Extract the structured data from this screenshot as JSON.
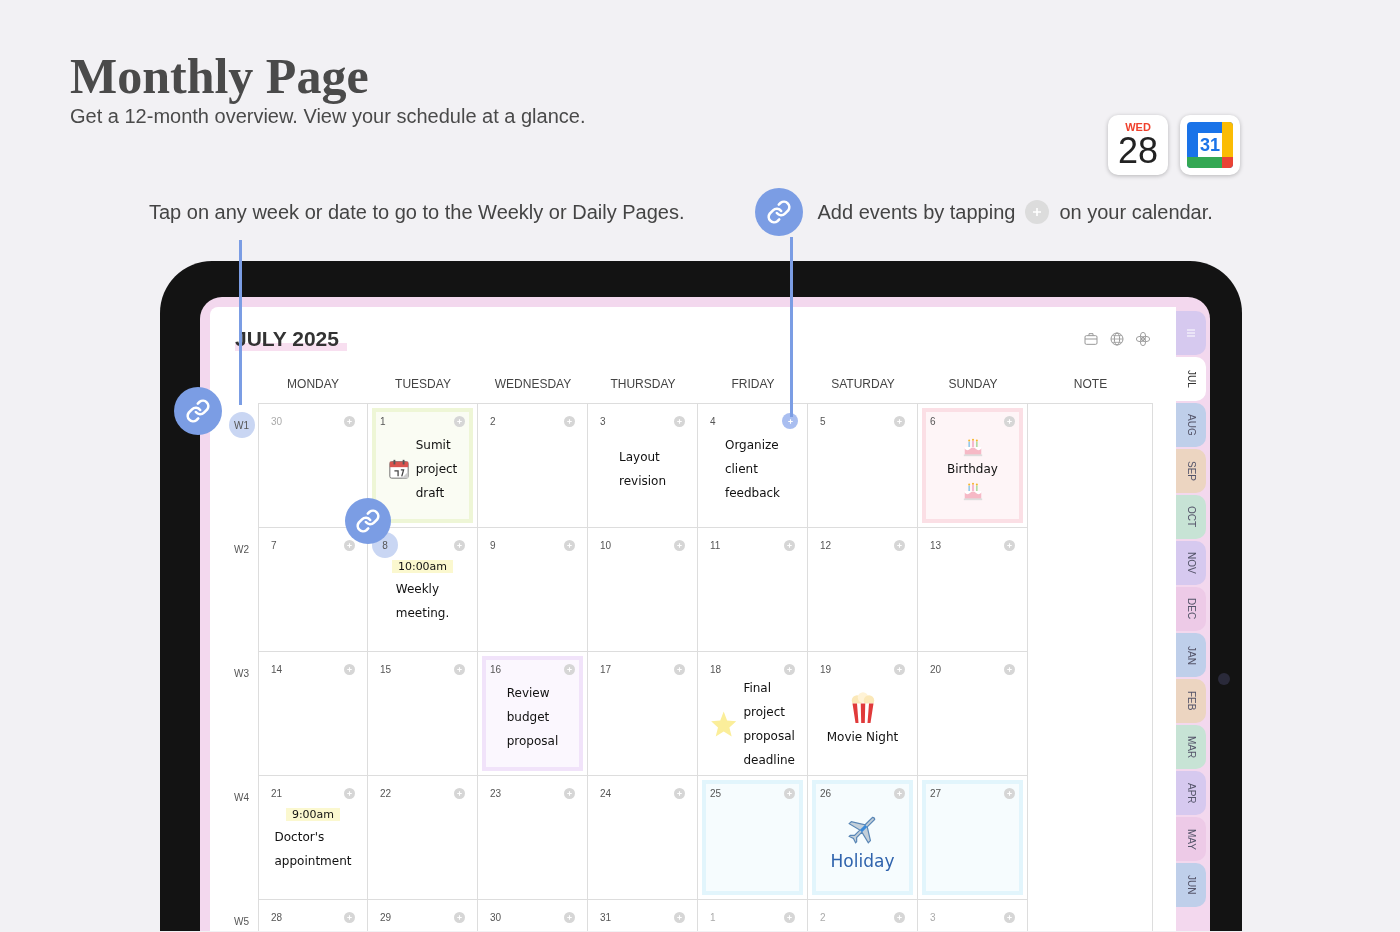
{
  "heading": {
    "title": "Monthly Page",
    "subtitle": "Get a 12-month overview. View your schedule at a glance."
  },
  "app_icons": [
    {
      "kind": "apple-calendar",
      "day": "WED",
      "date": "28"
    },
    {
      "kind": "google-calendar",
      "date": "31"
    }
  ],
  "callouts": [
    {
      "kind": "week",
      "text": "Tap on any week or date to go to the Weekly or Daily Pages."
    },
    {
      "kind": "add",
      "text_before": "Add events by tapping",
      "text_after": "on your calendar."
    }
  ],
  "planner": {
    "month_title": "JULY 2025",
    "columns": [
      "MONDAY",
      "TUESDAY",
      "WEDNESDAY",
      "THURSDAY",
      "FRIDAY",
      "SATURDAY",
      "SUNDAY",
      "NOTE"
    ],
    "weeks": [
      {
        "label": "W1",
        "highlighted": true,
        "days": [
          {
            "date": "30",
            "muted": true
          },
          {
            "date": "1",
            "color": "#eef6d6",
            "parts": [
              {
                "kind": "calendar-sticker"
              },
              {
                "kind": "note",
                "text": "Sumit project draft"
              }
            ]
          },
          {
            "date": "2"
          },
          {
            "date": "3",
            "parts": [
              {
                "kind": "note",
                "text": "Layout revision"
              }
            ]
          },
          {
            "date": "4",
            "plus_highlighted": true,
            "parts": [
              {
                "kind": "note",
                "text": "Organize client feedback"
              }
            ]
          },
          {
            "date": "5"
          },
          {
            "date": "6",
            "color": "#fbdfe5",
            "parts": [
              {
                "kind": "cake-sticker"
              },
              {
                "kind": "label",
                "text": "Birthday"
              },
              {
                "kind": "cake-sticker"
              }
            ]
          }
        ]
      },
      {
        "label": "W2",
        "highlighted": false,
        "days": [
          {
            "date": "7"
          },
          {
            "date": "8",
            "date_highlighted": true,
            "parts": [
              {
                "kind": "time",
                "text": "10:00am"
              },
              {
                "kind": "note",
                "text": "Weekly meeting."
              }
            ]
          },
          {
            "date": "9"
          },
          {
            "date": "10"
          },
          {
            "date": "11"
          },
          {
            "date": "12"
          },
          {
            "date": "13"
          }
        ]
      },
      {
        "label": "W3",
        "highlighted": false,
        "days": [
          {
            "date": "14"
          },
          {
            "date": "15"
          },
          {
            "date": "16",
            "color": "#f1e3fa",
            "parts": [
              {
                "kind": "note",
                "text": "Review budget proposal"
              }
            ]
          },
          {
            "date": "17"
          },
          {
            "date": "18",
            "parts": [
              {
                "kind": "star-sticker"
              },
              {
                "kind": "note",
                "text": "Final project proposal deadline"
              }
            ]
          },
          {
            "date": "19",
            "parts": [
              {
                "kind": "popcorn-sticker"
              },
              {
                "kind": "label",
                "text": "Movie Night"
              }
            ]
          },
          {
            "date": "20"
          }
        ]
      },
      {
        "label": "W4",
        "highlighted": false,
        "days": [
          {
            "date": "21",
            "parts": [
              {
                "kind": "time",
                "text": "9:00am"
              },
              {
                "kind": "note",
                "text": "Doctor's appointment"
              }
            ]
          },
          {
            "date": "22"
          },
          {
            "date": "23"
          },
          {
            "date": "24"
          },
          {
            "date": "25",
            "color": "#e2f5fc"
          },
          {
            "date": "26",
            "color": "#e2f5fc",
            "parts": [
              {
                "kind": "airplane-sticker"
              },
              {
                "kind": "label",
                "text": "Holiday",
                "color": "#2f63ad"
              }
            ]
          },
          {
            "date": "27",
            "color": "#e2f5fc"
          }
        ]
      },
      {
        "label": "W5",
        "highlighted": false,
        "days": [
          {
            "date": "28"
          },
          {
            "date": "29"
          },
          {
            "date": "30"
          },
          {
            "date": "31"
          },
          {
            "date": "1",
            "muted": true
          },
          {
            "date": "2",
            "muted": true
          },
          {
            "date": "3",
            "muted": true
          }
        ]
      }
    ]
  },
  "tabs": [
    {
      "kind": "menu",
      "selected": false,
      "color": "#d6c9ef"
    },
    {
      "kind": "month",
      "label": "JUL",
      "selected": true
    },
    {
      "kind": "month",
      "label": "AUG",
      "selected": false,
      "color": "#bfcfea"
    },
    {
      "kind": "month",
      "label": "SEP",
      "selected": false,
      "color": "#ecd5c1"
    },
    {
      "kind": "month",
      "label": "OCT",
      "selected": false,
      "color": "#c7e3d5"
    },
    {
      "kind": "month",
      "label": "NOV",
      "selected": false,
      "color": "#d6c9ef"
    },
    {
      "kind": "month",
      "label": "DEC",
      "selected": false,
      "color": "#edcae7"
    },
    {
      "kind": "month",
      "label": "JAN",
      "selected": false,
      "color": "#bfcfea"
    },
    {
      "kind": "month",
      "label": "FEB",
      "selected": false,
      "color": "#ecd5c1"
    },
    {
      "kind": "month",
      "label": "MAR",
      "selected": false,
      "color": "#c7e3d5"
    },
    {
      "kind": "month",
      "label": "APR",
      "selected": false,
      "color": "#d6c9ef"
    },
    {
      "kind": "month",
      "label": "MAY",
      "selected": false,
      "color": "#edcae7"
    },
    {
      "kind": "month",
      "label": "JUN",
      "selected": false,
      "color": "#bfcfea"
    }
  ]
}
